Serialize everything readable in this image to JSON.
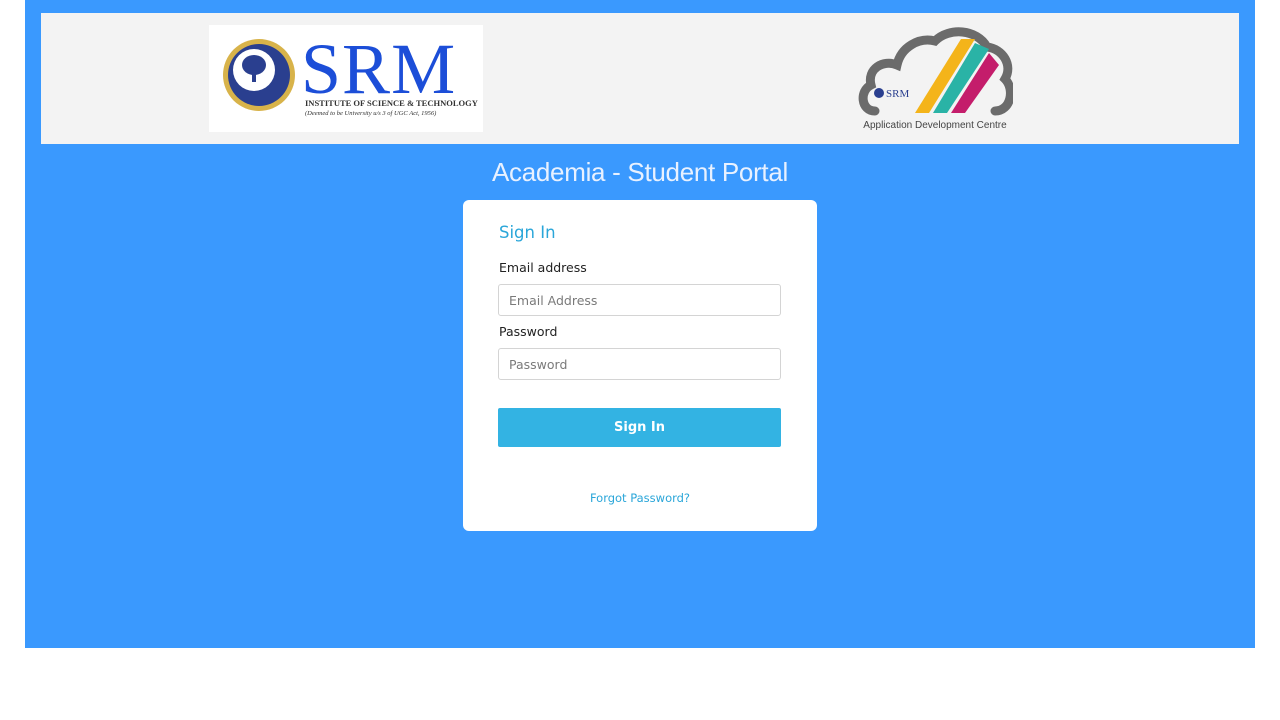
{
  "header": {
    "srm_logo": {
      "wordmark": "SRM",
      "line1": "INSTITUTE OF SCIENCE & TECHNOLOGY",
      "line2": "(Deemed to be University u/s 3 of UGC Act, 1956)"
    },
    "adc_logo": {
      "caption": "Application Development Centre",
      "badge": "SRM"
    }
  },
  "portal_title": "Academia - Student Portal",
  "signin_form": {
    "title": "Sign In",
    "email_label": "Email address",
    "email_placeholder": "Email Address",
    "email_value": "",
    "password_label": "Password",
    "password_placeholder": "Password",
    "password_value": "",
    "submit_label": "Sign In",
    "forgot_label": "Forgot Password?"
  },
  "colors": {
    "page_background": "#3a99fe",
    "header_band": "#f3f3f3",
    "accent": "#33b3e3",
    "link": "#2aa6d9"
  }
}
